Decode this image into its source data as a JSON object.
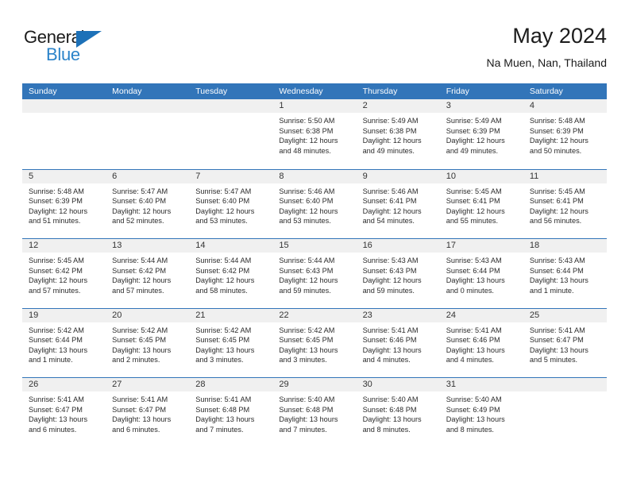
{
  "logo": {
    "word_top": "General",
    "word_bottom": "Blue",
    "triangle_color": "#1d71b8",
    "blue_text_color": "#2b83c9"
  },
  "header": {
    "title": "May 2024",
    "subtitle": "Na Muen, Nan, Thailand"
  },
  "theme": {
    "header_blue": "#3275b9",
    "day_band_gray": "#f0f0f0",
    "text_color": "#2b2b2b"
  },
  "weekdays": [
    "Sunday",
    "Monday",
    "Tuesday",
    "Wednesday",
    "Thursday",
    "Friday",
    "Saturday"
  ],
  "weeks": [
    [
      {
        "day": "",
        "sunrise": "",
        "sunset": "",
        "daylight_1": "",
        "daylight_2": ""
      },
      {
        "day": "",
        "sunrise": "",
        "sunset": "",
        "daylight_1": "",
        "daylight_2": ""
      },
      {
        "day": "",
        "sunrise": "",
        "sunset": "",
        "daylight_1": "",
        "daylight_2": ""
      },
      {
        "day": "1",
        "sunrise": "Sunrise: 5:50 AM",
        "sunset": "Sunset: 6:38 PM",
        "daylight_1": "Daylight: 12 hours",
        "daylight_2": "and 48 minutes."
      },
      {
        "day": "2",
        "sunrise": "Sunrise: 5:49 AM",
        "sunset": "Sunset: 6:38 PM",
        "daylight_1": "Daylight: 12 hours",
        "daylight_2": "and 49 minutes."
      },
      {
        "day": "3",
        "sunrise": "Sunrise: 5:49 AM",
        "sunset": "Sunset: 6:39 PM",
        "daylight_1": "Daylight: 12 hours",
        "daylight_2": "and 49 minutes."
      },
      {
        "day": "4",
        "sunrise": "Sunrise: 5:48 AM",
        "sunset": "Sunset: 6:39 PM",
        "daylight_1": "Daylight: 12 hours",
        "daylight_2": "and 50 minutes."
      }
    ],
    [
      {
        "day": "5",
        "sunrise": "Sunrise: 5:48 AM",
        "sunset": "Sunset: 6:39 PM",
        "daylight_1": "Daylight: 12 hours",
        "daylight_2": "and 51 minutes."
      },
      {
        "day": "6",
        "sunrise": "Sunrise: 5:47 AM",
        "sunset": "Sunset: 6:40 PM",
        "daylight_1": "Daylight: 12 hours",
        "daylight_2": "and 52 minutes."
      },
      {
        "day": "7",
        "sunrise": "Sunrise: 5:47 AM",
        "sunset": "Sunset: 6:40 PM",
        "daylight_1": "Daylight: 12 hours",
        "daylight_2": "and 53 minutes."
      },
      {
        "day": "8",
        "sunrise": "Sunrise: 5:46 AM",
        "sunset": "Sunset: 6:40 PM",
        "daylight_1": "Daylight: 12 hours",
        "daylight_2": "and 53 minutes."
      },
      {
        "day": "9",
        "sunrise": "Sunrise: 5:46 AM",
        "sunset": "Sunset: 6:41 PM",
        "daylight_1": "Daylight: 12 hours",
        "daylight_2": "and 54 minutes."
      },
      {
        "day": "10",
        "sunrise": "Sunrise: 5:45 AM",
        "sunset": "Sunset: 6:41 PM",
        "daylight_1": "Daylight: 12 hours",
        "daylight_2": "and 55 minutes."
      },
      {
        "day": "11",
        "sunrise": "Sunrise: 5:45 AM",
        "sunset": "Sunset: 6:41 PM",
        "daylight_1": "Daylight: 12 hours",
        "daylight_2": "and 56 minutes."
      }
    ],
    [
      {
        "day": "12",
        "sunrise": "Sunrise: 5:45 AM",
        "sunset": "Sunset: 6:42 PM",
        "daylight_1": "Daylight: 12 hours",
        "daylight_2": "and 57 minutes."
      },
      {
        "day": "13",
        "sunrise": "Sunrise: 5:44 AM",
        "sunset": "Sunset: 6:42 PM",
        "daylight_1": "Daylight: 12 hours",
        "daylight_2": "and 57 minutes."
      },
      {
        "day": "14",
        "sunrise": "Sunrise: 5:44 AM",
        "sunset": "Sunset: 6:42 PM",
        "daylight_1": "Daylight: 12 hours",
        "daylight_2": "and 58 minutes."
      },
      {
        "day": "15",
        "sunrise": "Sunrise: 5:44 AM",
        "sunset": "Sunset: 6:43 PM",
        "daylight_1": "Daylight: 12 hours",
        "daylight_2": "and 59 minutes."
      },
      {
        "day": "16",
        "sunrise": "Sunrise: 5:43 AM",
        "sunset": "Sunset: 6:43 PM",
        "daylight_1": "Daylight: 12 hours",
        "daylight_2": "and 59 minutes."
      },
      {
        "day": "17",
        "sunrise": "Sunrise: 5:43 AM",
        "sunset": "Sunset: 6:44 PM",
        "daylight_1": "Daylight: 13 hours",
        "daylight_2": "and 0 minutes."
      },
      {
        "day": "18",
        "sunrise": "Sunrise: 5:43 AM",
        "sunset": "Sunset: 6:44 PM",
        "daylight_1": "Daylight: 13 hours",
        "daylight_2": "and 1 minute."
      }
    ],
    [
      {
        "day": "19",
        "sunrise": "Sunrise: 5:42 AM",
        "sunset": "Sunset: 6:44 PM",
        "daylight_1": "Daylight: 13 hours",
        "daylight_2": "and 1 minute."
      },
      {
        "day": "20",
        "sunrise": "Sunrise: 5:42 AM",
        "sunset": "Sunset: 6:45 PM",
        "daylight_1": "Daylight: 13 hours",
        "daylight_2": "and 2 minutes."
      },
      {
        "day": "21",
        "sunrise": "Sunrise: 5:42 AM",
        "sunset": "Sunset: 6:45 PM",
        "daylight_1": "Daylight: 13 hours",
        "daylight_2": "and 3 minutes."
      },
      {
        "day": "22",
        "sunrise": "Sunrise: 5:42 AM",
        "sunset": "Sunset: 6:45 PM",
        "daylight_1": "Daylight: 13 hours",
        "daylight_2": "and 3 minutes."
      },
      {
        "day": "23",
        "sunrise": "Sunrise: 5:41 AM",
        "sunset": "Sunset: 6:46 PM",
        "daylight_1": "Daylight: 13 hours",
        "daylight_2": "and 4 minutes."
      },
      {
        "day": "24",
        "sunrise": "Sunrise: 5:41 AM",
        "sunset": "Sunset: 6:46 PM",
        "daylight_1": "Daylight: 13 hours",
        "daylight_2": "and 4 minutes."
      },
      {
        "day": "25",
        "sunrise": "Sunrise: 5:41 AM",
        "sunset": "Sunset: 6:47 PM",
        "daylight_1": "Daylight: 13 hours",
        "daylight_2": "and 5 minutes."
      }
    ],
    [
      {
        "day": "26",
        "sunrise": "Sunrise: 5:41 AM",
        "sunset": "Sunset: 6:47 PM",
        "daylight_1": "Daylight: 13 hours",
        "daylight_2": "and 6 minutes."
      },
      {
        "day": "27",
        "sunrise": "Sunrise: 5:41 AM",
        "sunset": "Sunset: 6:47 PM",
        "daylight_1": "Daylight: 13 hours",
        "daylight_2": "and 6 minutes."
      },
      {
        "day": "28",
        "sunrise": "Sunrise: 5:41 AM",
        "sunset": "Sunset: 6:48 PM",
        "daylight_1": "Daylight: 13 hours",
        "daylight_2": "and 7 minutes."
      },
      {
        "day": "29",
        "sunrise": "Sunrise: 5:40 AM",
        "sunset": "Sunset: 6:48 PM",
        "daylight_1": "Daylight: 13 hours",
        "daylight_2": "and 7 minutes."
      },
      {
        "day": "30",
        "sunrise": "Sunrise: 5:40 AM",
        "sunset": "Sunset: 6:48 PM",
        "daylight_1": "Daylight: 13 hours",
        "daylight_2": "and 8 minutes."
      },
      {
        "day": "31",
        "sunrise": "Sunrise: 5:40 AM",
        "sunset": "Sunset: 6:49 PM",
        "daylight_1": "Daylight: 13 hours",
        "daylight_2": "and 8 minutes."
      },
      {
        "day": "",
        "sunrise": "",
        "sunset": "",
        "daylight_1": "",
        "daylight_2": ""
      }
    ]
  ]
}
